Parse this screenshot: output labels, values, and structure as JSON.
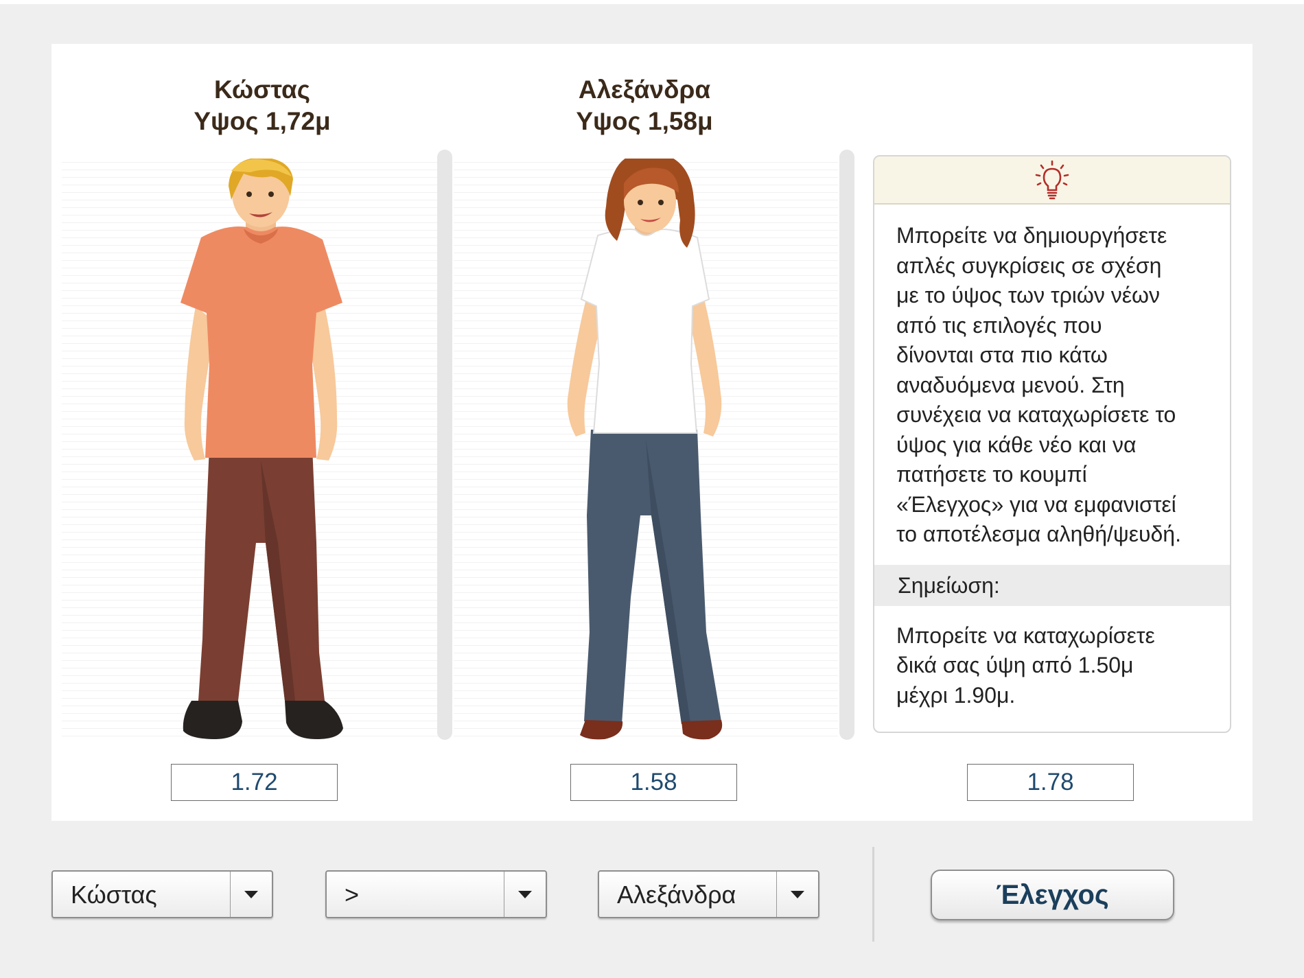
{
  "kostas": {
    "name": "Κώστας",
    "height_label": "Υψος 1,72μ",
    "value": "1.72"
  },
  "alexandra": {
    "name": "Αλεξάνδρα",
    "height_label": "Υψος 1,58μ",
    "value": "1.58"
  },
  "third": {
    "value": "1.78"
  },
  "tip": {
    "icon": "lightbulb-icon",
    "text": "Μπορείτε να δημιουργήσετε\nαπλές συγκρίσεις σε σχέση\nμε το ύψος των τριών νέων\nαπό τις επιλογές που\nδίνονται στα πιο κάτω\nαναδυόμενα μενού. Στη\nσυνέχεια να καταχωρίσετε το\nύψος για κάθε νέο και να\nπατήσετε το κουμπί\n«Έλεγχος» για να εμφανιστεί\nτο αποτέλεσμα αληθή/ψευδή.",
    "note_title": "Σημείωση:",
    "note_text": "Μπορείτε να καταχωρίσετε\nδικά σας ύψη από 1.50μ\nμέχρι 1.90μ."
  },
  "controls": {
    "select_person1": "Κώστας",
    "select_operator": ">",
    "select_person2": "Αλεξάνδρα",
    "check_button": "Έλεγχος"
  },
  "colors": {
    "title_text": "#3b2a1a",
    "value_text": "#1f4a6e",
    "tip_header_bg": "#f8f5e6",
    "tip_icon": "#b52c28",
    "button_text": "#1b3f5c"
  }
}
